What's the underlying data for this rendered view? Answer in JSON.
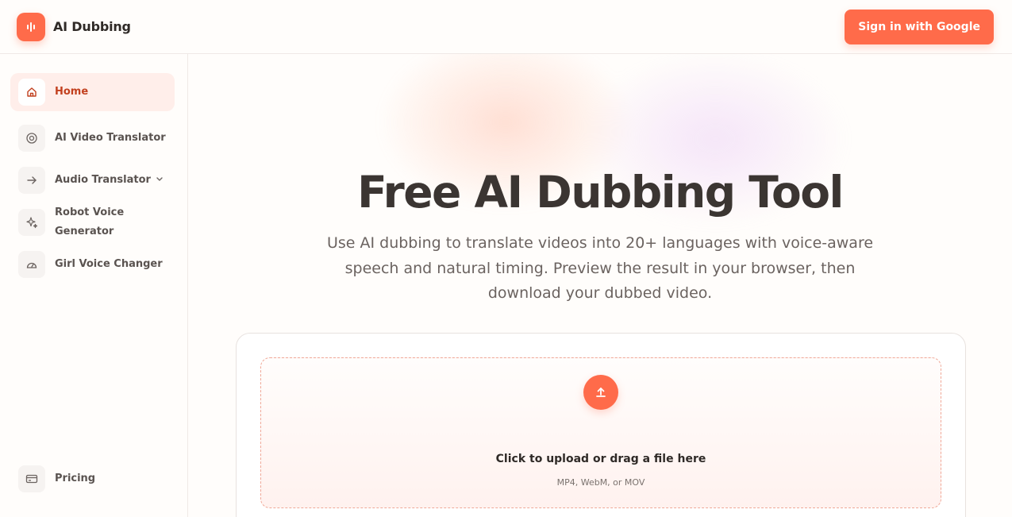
{
  "brand": {
    "name": "AI Dubbing",
    "icon": "waveform-icon",
    "color": "#ff6b4a"
  },
  "header": {
    "signin_label": "Sign in with Google"
  },
  "sidebar": {
    "items": [
      {
        "label": "Home",
        "icon": "home-icon",
        "active": true
      },
      {
        "label": "AI Video Translator",
        "icon": "target-icon"
      },
      {
        "label": "Audio Translator",
        "icon": "arrow-right-icon",
        "has_dropdown": true
      },
      {
        "label": "Robot Voice Generator",
        "icon": "sparkles-icon"
      },
      {
        "label": "Girl Voice Changer",
        "icon": "gauge-icon"
      }
    ],
    "pricing": {
      "label": "Pricing",
      "icon": "credit-card-icon"
    }
  },
  "hero": {
    "title": "Free AI Dubbing Tool",
    "subtitle": "Use AI dubbing to translate videos into 20+ languages with voice-aware speech and natural timing. Preview the result in your browser, then download your dubbed video."
  },
  "upload": {
    "title": "Click to upload or drag a file here",
    "hint": "MP4, WebM, or MOV",
    "icon": "upload-icon"
  },
  "colors": {
    "accent": "#ff6b4a",
    "active_bg": "#ffeeea",
    "active_text": "#c2401f"
  }
}
